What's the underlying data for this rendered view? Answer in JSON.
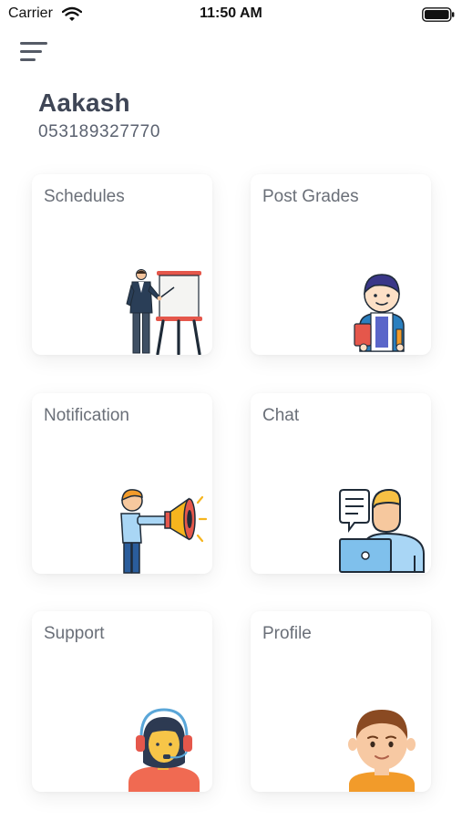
{
  "status_bar": {
    "carrier": "Carrier",
    "time": "11:50 AM",
    "icons": [
      "wifi-icon",
      "battery-icon"
    ]
  },
  "menu": {
    "icon": "hamburger-menu-icon"
  },
  "user": {
    "name": "Aakash",
    "phone": "053189327770"
  },
  "cards": [
    {
      "label": "Schedules",
      "icon": "teacher-presentation-icon"
    },
    {
      "label": "Post Grades",
      "icon": "student-icon"
    },
    {
      "label": "Notification",
      "icon": "megaphone-icon"
    },
    {
      "label": "Chat",
      "icon": "chat-laptop-icon"
    },
    {
      "label": "Support",
      "icon": "headset-support-icon"
    },
    {
      "label": "Profile",
      "icon": "profile-avatar-icon"
    }
  ],
  "colors": {
    "title_text": "#3f4656",
    "card_label": "#6a6f78",
    "card_bg": "#ffffff",
    "accent_red": "#e5574b",
    "accent_blue": "#2a7fbf",
    "accent_orange": "#f29b2a"
  }
}
